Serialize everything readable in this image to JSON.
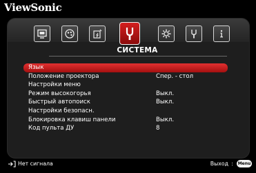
{
  "brand": "ViewSonic",
  "tabs": [
    {
      "icon": "picture-icon",
      "active": false
    },
    {
      "icon": "color-icon",
      "active": false
    },
    {
      "icon": "power-icon",
      "active": false
    },
    {
      "icon": "system-icon",
      "active": true
    },
    {
      "icon": "advanced-icon",
      "active": false
    },
    {
      "icon": "settings-icon",
      "active": false
    },
    {
      "icon": "information-icon",
      "active": false
    }
  ],
  "active_tab_title": "СИСТЕМА",
  "menu": [
    {
      "label": "Язык",
      "value": "",
      "selected": true
    },
    {
      "label": "Положение проектора",
      "value": "Спер. - стол",
      "selected": false
    },
    {
      "label": "Настройки меню",
      "value": "",
      "selected": false
    },
    {
      "label": "Режим высокогорья",
      "value": "Выкл.",
      "selected": false
    },
    {
      "label": "Быстрый автопоиск",
      "value": "Выкл.",
      "selected": false
    },
    {
      "label": "Настройки безопасн.",
      "value": "",
      "selected": false
    },
    {
      "label": "Блокировка клавиш панели",
      "value": "Выкл.",
      "selected": false
    },
    {
      "label": "Код пульта ДУ",
      "value": "8",
      "selected": false
    }
  ],
  "footer": {
    "signal_status": "Нет сигнала",
    "exit_label": "Выход",
    "exit_separator": ":",
    "menu_button": "Menu"
  },
  "colors": {
    "accent": "#c81414",
    "panel": "#1e1e1e",
    "background": "#000000"
  }
}
